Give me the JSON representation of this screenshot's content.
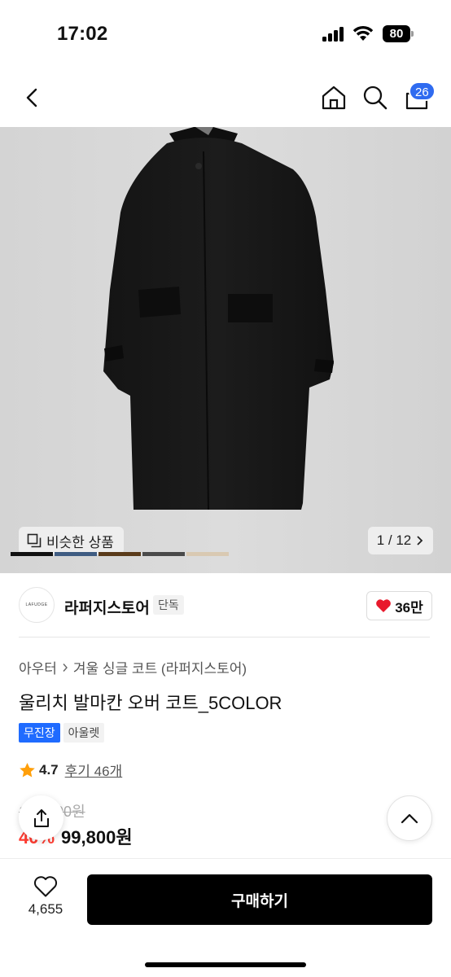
{
  "status_bar": {
    "time": "17:02",
    "battery": "80"
  },
  "nav": {
    "cart_count": "26"
  },
  "hero": {
    "similar_label": "비슷한 상품",
    "pager_text": "1 / 12",
    "swatch_colors": [
      "#111111",
      "#3f5c82",
      "#5a3b1a",
      "#4a4a4a",
      "#d9c9b2"
    ]
  },
  "store": {
    "logo_text": "LAFUDGE",
    "name": "라퍼지스토어",
    "exclusive_tag": "단독",
    "like_count": "36만"
  },
  "product": {
    "breadcrumb": [
      "아우터",
      "겨울 싱글 코트 (라퍼지스토어)"
    ],
    "title": "울리치 발마칸 오버 코트_5COLOR",
    "tags": [
      "무진장",
      "아울렛"
    ],
    "rating": "4.7",
    "review_label": "후기 46개",
    "original_price": "166,300원",
    "discount": "40%",
    "sale_price": "99,800원"
  },
  "bottom_bar": {
    "wish_count": "4,655",
    "buy_label": "구매하기"
  },
  "colors": {
    "accent_blue": "#1f6bff",
    "discount_red": "#ff3b30",
    "heart_red": "#e8192c",
    "star_orange": "#ff9f0a"
  }
}
